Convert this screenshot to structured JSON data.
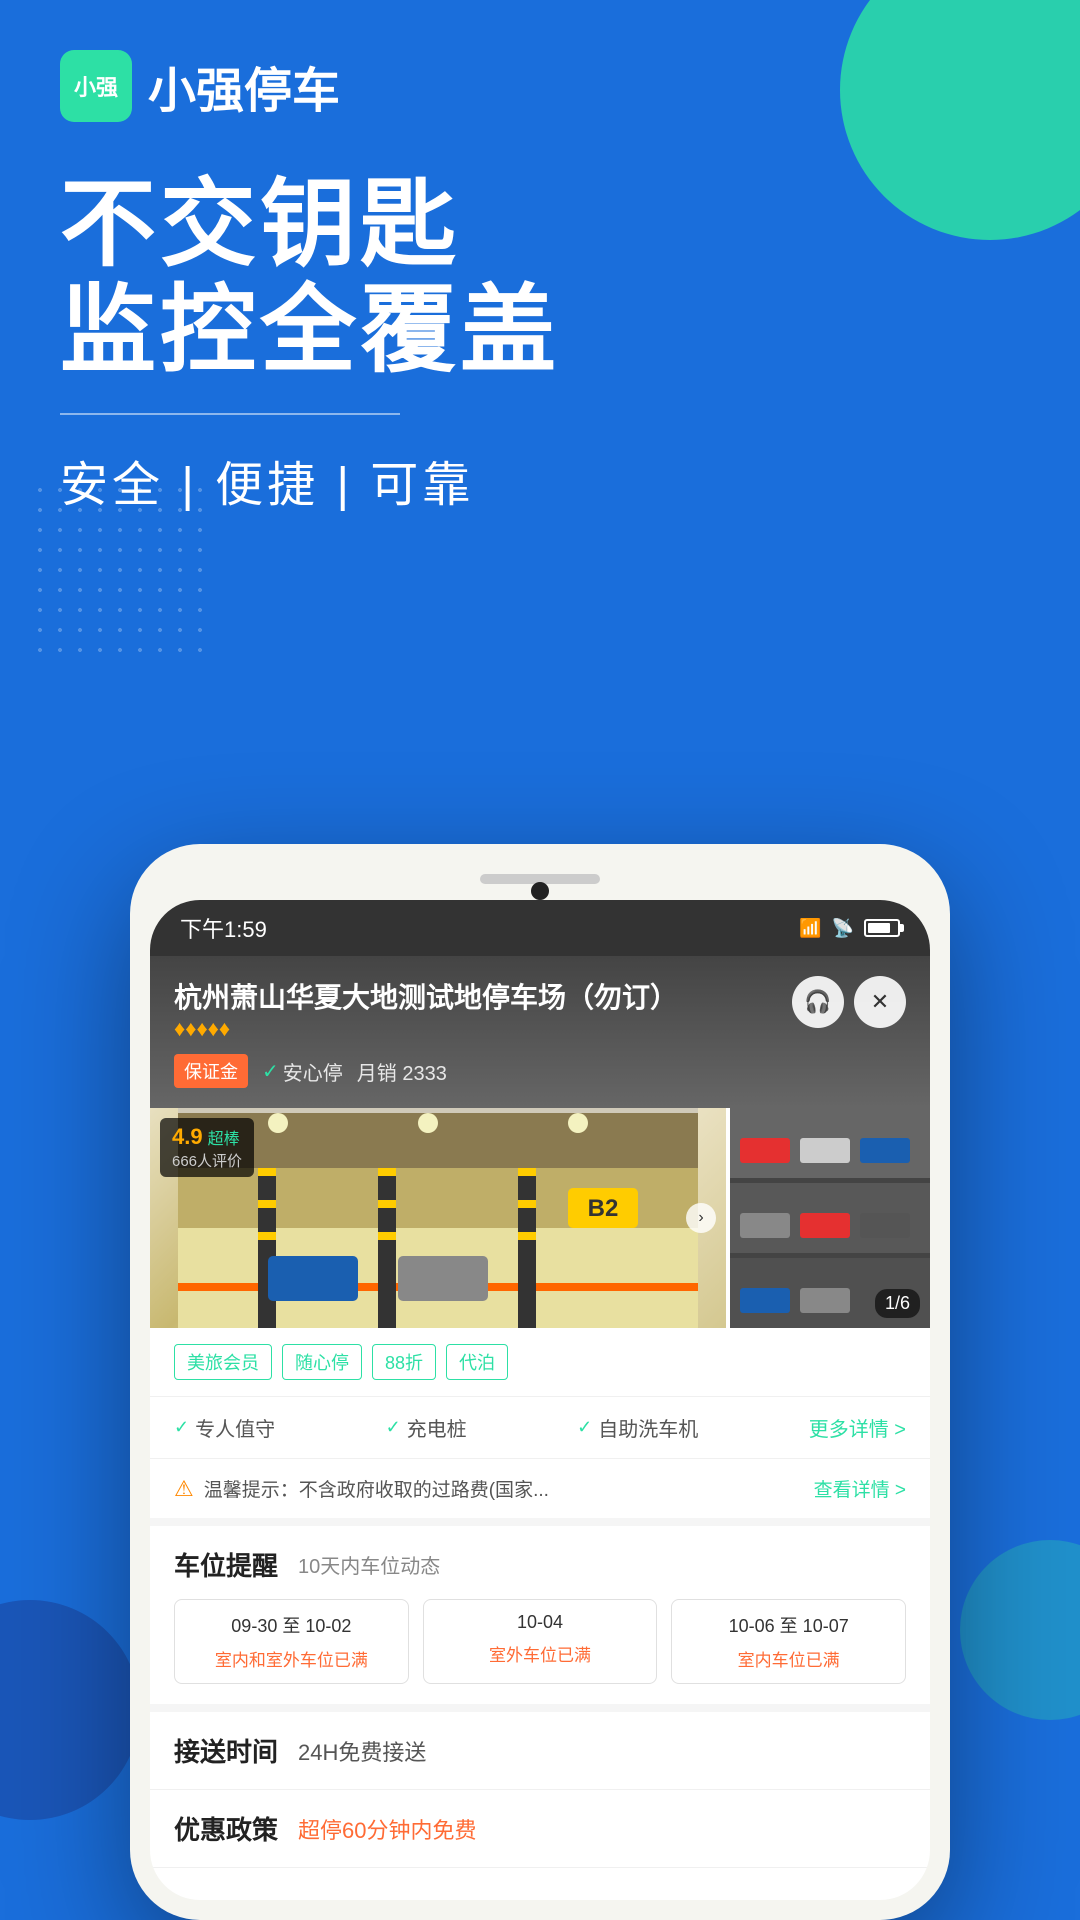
{
  "app": {
    "logo_text": "小强",
    "name": "小强停车"
  },
  "hero": {
    "line1": "不交钥匙",
    "line2": "监控全覆盖",
    "tagline": "安全 | 便捷 | 可靠"
  },
  "status_bar": {
    "time": "下午1:59",
    "signal": "HD",
    "battery": ""
  },
  "parking_lot": {
    "title": "杭州萧山华夏大地测试地停车场（勿订）",
    "stars": "♦♦♦♦♦",
    "tags": {
      "guarantee": "保证金",
      "safety": "安心停",
      "monthly_sales": "月销 2333"
    },
    "rating": {
      "score": "4.9",
      "label": "超棒",
      "count": "666人评价"
    },
    "image_counter": "1/6"
  },
  "feature_tags": [
    "美旅会员",
    "随心停",
    "88折",
    "代泊"
  ],
  "amenities": {
    "items": [
      "专人值守",
      "充电桩",
      "自助洗车机"
    ],
    "more": "更多详情 >"
  },
  "warning": {
    "text": "温馨提示：不含政府收取的过路费(国家...",
    "link": "查看详情 >"
  },
  "space_reminder": {
    "title": "车位提醒",
    "subtitle": "10天内车位动态",
    "dates": [
      {
        "range": "09-30 至 10-02",
        "status": "室内和室外车位已满"
      },
      {
        "range": "10-04",
        "status": "室外车位已满"
      },
      {
        "range": "10-06 至 10-07",
        "status": "室内车位已满"
      }
    ]
  },
  "transfer": {
    "label": "接送时间",
    "value": "24H免费接送"
  },
  "discount": {
    "label": "优惠政策",
    "value": "超停60分钟内免费"
  },
  "actions": {
    "headset": "🎧",
    "close": "✕"
  }
}
